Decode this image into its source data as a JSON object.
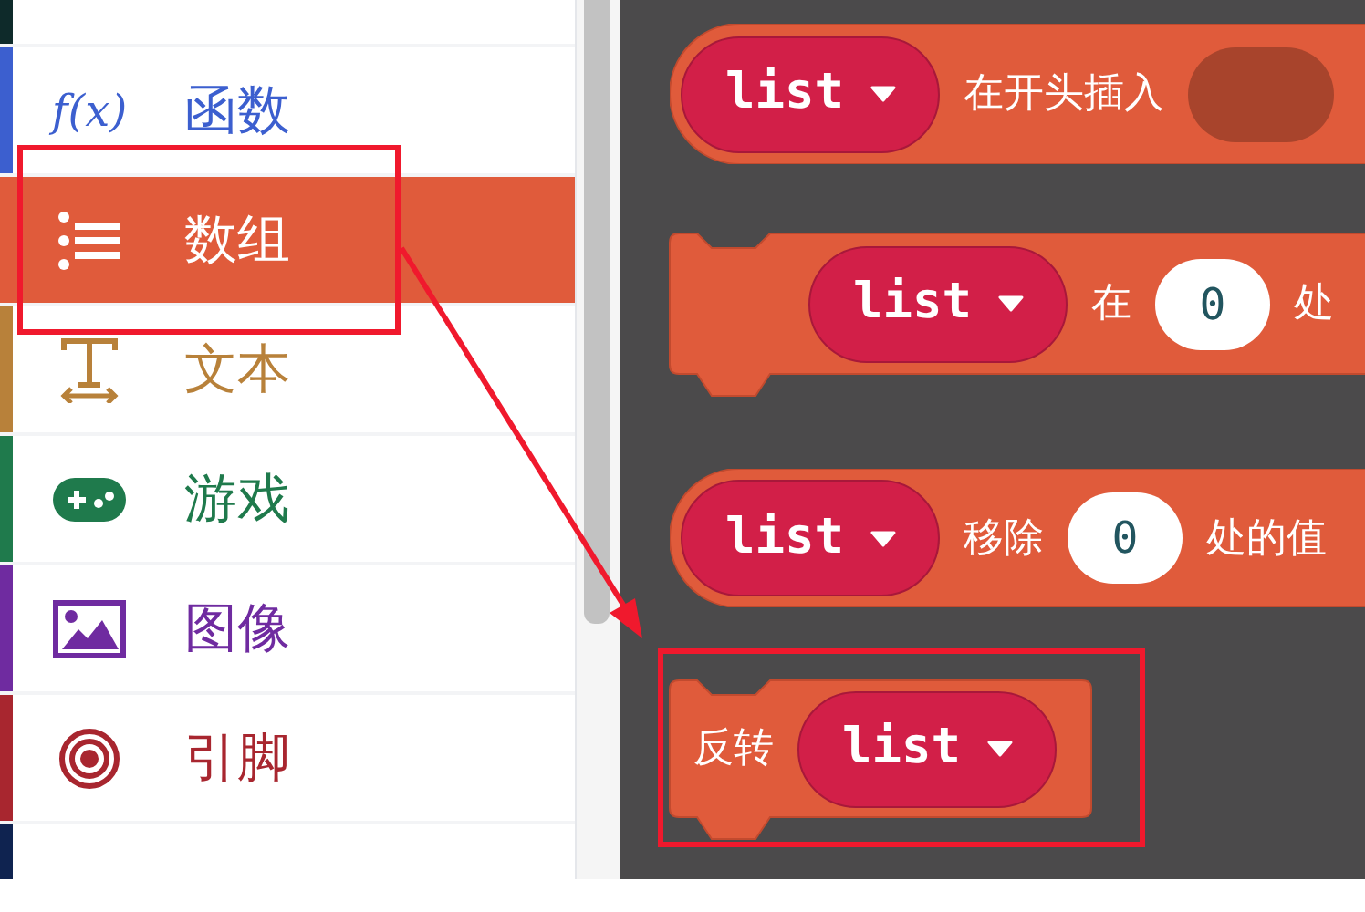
{
  "sidebar": {
    "items": [
      {
        "label": "函数",
        "color": "#3c5fcf",
        "selected": false,
        "icon_text": "f(x)"
      },
      {
        "label": "数组",
        "color": "#e05b3b",
        "selected": true
      },
      {
        "label": "文本",
        "color": "#b8813a",
        "selected": false
      },
      {
        "label": "游戏",
        "color": "#1f7a4c",
        "selected": false
      },
      {
        "label": "图像",
        "color": "#6f2ba0",
        "selected": false
      },
      {
        "label": "引脚",
        "color": "#a8262f",
        "selected": false
      }
    ]
  },
  "canvas": {
    "blocks": [
      {
        "kind": "pill",
        "parts": [
          {
            "kind": "variable",
            "text": "list"
          },
          {
            "kind": "text",
            "text": "在开头插入"
          },
          {
            "kind": "slot"
          }
        ]
      },
      {
        "kind": "notched",
        "parts": [
          {
            "kind": "variable",
            "text": "list"
          },
          {
            "kind": "text",
            "text": "在"
          },
          {
            "kind": "number",
            "text": "0"
          },
          {
            "kind": "text",
            "text": "处"
          }
        ]
      },
      {
        "kind": "pill",
        "parts": [
          {
            "kind": "variable",
            "text": "list"
          },
          {
            "kind": "text",
            "text": "移除"
          },
          {
            "kind": "number",
            "text": "0"
          },
          {
            "kind": "text",
            "text": "处的值"
          }
        ]
      },
      {
        "kind": "notched",
        "parts": [
          {
            "kind": "text",
            "text": "反转"
          },
          {
            "kind": "variable",
            "text": "list"
          }
        ]
      }
    ]
  }
}
